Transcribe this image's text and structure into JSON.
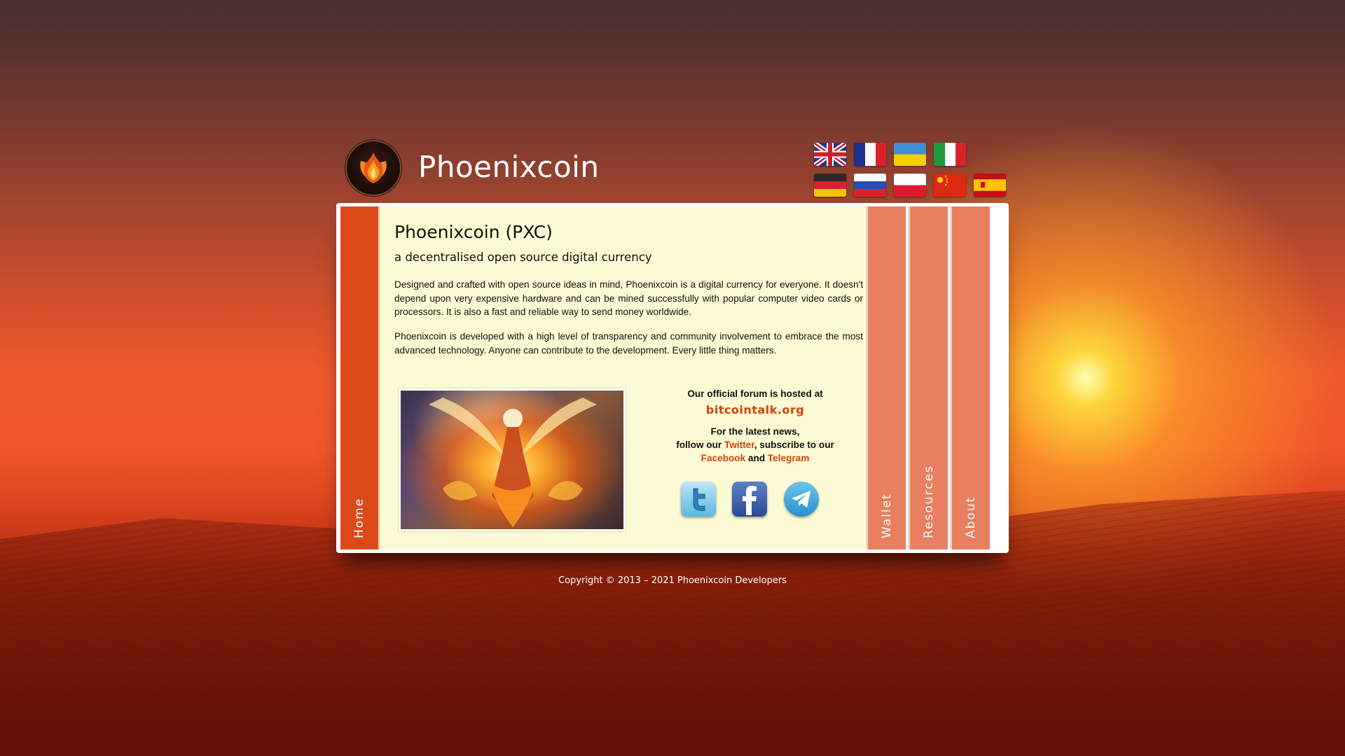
{
  "header": {
    "site_title": "Phoenixcoin",
    "flags": [
      {
        "lang": "english",
        "icon": "uk-flag-icon"
      },
      {
        "lang": "french",
        "icon": "france-flag-icon"
      },
      {
        "lang": "ukrainian",
        "icon": "ukraine-flag-icon"
      },
      {
        "lang": "italian",
        "icon": "italy-flag-icon"
      },
      {
        "lang": "german",
        "icon": "germany-flag-icon"
      },
      {
        "lang": "russian",
        "icon": "russia-flag-icon"
      },
      {
        "lang": "polish",
        "icon": "poland-flag-icon"
      },
      {
        "lang": "chinese",
        "icon": "china-flag-icon"
      },
      {
        "lang": "spanish",
        "icon": "spain-flag-icon"
      }
    ]
  },
  "nav": {
    "home": "Home",
    "wallet": "Wallet",
    "resources": "Resources",
    "about": "About"
  },
  "main": {
    "heading": "Phoenixcoin (PXC)",
    "subheading": "a decentralised open source digital currency",
    "paragraphs": [
      "Designed and crafted with open source ideas in mind, Phoenixcoin is a digital currency for everyone. It doesn't depend upon very expensive hardware and can be mined successfully with popular computer video cards or processors. It is also a fast and reliable way to send money worldwide.",
      "Phoenixcoin is developed with a high level of transparency and community involvement to embrace the most advanced technology. Anyone can contribute to the development. Every little thing matters."
    ]
  },
  "social": {
    "forum_intro": "Our official forum is hosted at",
    "forum_link": "bitcointalk.org",
    "news_line1": "For the latest news,",
    "follow_our": "follow our ",
    "twitter": "Twitter",
    "subscribe_to_our": ", subscribe to our",
    "facebook": "Facebook",
    "and": " and ",
    "telegram": "Telegram"
  },
  "colors": {
    "home_tab": "#dd4a1a",
    "side_tabs": "#e87f60",
    "content_bg": "#fbfad4",
    "link": "#d4420f"
  },
  "footer": {
    "copyright": "Copyright © 2013 – 2021 Phoenixcoin Developers"
  }
}
